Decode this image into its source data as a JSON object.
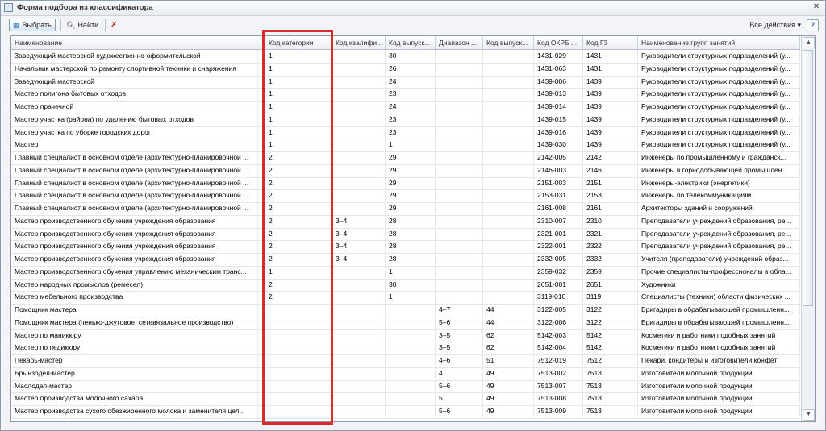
{
  "window": {
    "title": "Форма подбора из классификатора"
  },
  "toolbar": {
    "select_label": "Выбрать",
    "find_label": "Найти...",
    "all_actions": "Все действия ▾",
    "help": "?"
  },
  "grid": {
    "columns": [
      "Наименование",
      "Код категории",
      "Код квалифи...",
      "Код выпуск...",
      "Диапазон ...",
      "Код выпуск...",
      "Код ОКРБ ...",
      "Код ГЗ",
      "Наименование групп занятий"
    ],
    "rows": [
      [
        "Заведующий мастерской художественно-оформительской",
        "1",
        "",
        "30",
        "",
        "",
        "1431-029",
        "1431",
        "Руководители структурных подразделений (у..."
      ],
      [
        "Начальник мастерской по ремонту спортивной техники и снаряжения",
        "1",
        "",
        "26",
        "",
        "",
        "1431-063",
        "1431",
        "Руководители структурных подразделений (у..."
      ],
      [
        "Заведующий мастерской",
        "1",
        "",
        "24",
        "",
        "",
        "1439-006",
        "1439",
        "Руководители структурных подразделений (у..."
      ],
      [
        "Мастер полигона бытовых отходов",
        "1",
        "",
        "23",
        "",
        "",
        "1439-013",
        "1439",
        "Руководители структурных подразделений (у..."
      ],
      [
        "Мастер прачечной",
        "1",
        "",
        "24",
        "",
        "",
        "1439-014",
        "1439",
        "Руководители структурных подразделений (у..."
      ],
      [
        "Мастер участка (района) по удалению бытовых отходов",
        "1",
        "",
        "23",
        "",
        "",
        "1439-015",
        "1439",
        "Руководители структурных подразделений (у..."
      ],
      [
        "Мастер участка по уборке городских дорог",
        "1",
        "",
        "23",
        "",
        "",
        "1439-016",
        "1439",
        "Руководители структурных подразделений (у..."
      ],
      [
        "Мастер",
        "1",
        "",
        "1",
        "",
        "",
        "1439-030",
        "1439",
        "Руководители структурных подразделений (у..."
      ],
      [
        "Главный специалист в основном отделе (архитектурно-планировочной ...",
        "2",
        "",
        "29",
        "",
        "",
        "2142-005",
        "2142",
        "Инженеры по промышленному и гражданск..."
      ],
      [
        "Главный специалист в основном отделе (архитектурно-планировочной ...",
        "2",
        "",
        "29",
        "",
        "",
        "2146-003",
        "2146",
        "Инженеры в горнодобывающей промышлен..."
      ],
      [
        "Главный специалист в основном отделе (архитектурно-планировочной ...",
        "2",
        "",
        "29",
        "",
        "",
        "2151-003",
        "2151",
        "Инженеры-электрики (энергетики)"
      ],
      [
        "Главный специалист в основном отделе (архитектурно-планировочной ...",
        "2",
        "",
        "29",
        "",
        "",
        "2153-031",
        "2153",
        "Инженеры по телекоммуникациям"
      ],
      [
        "Главный специалист в основном отделе (архитектурно-планировочной ...",
        "2",
        "",
        "29",
        "",
        "",
        "2161-008",
        "2161",
        "Архитекторы зданий и сооружений"
      ],
      [
        "Мастер производственного обучения учреждения образования",
        "2",
        "3–4",
        "28",
        "",
        "",
        "2310-007",
        "2310",
        "Преподаватели учреждений образования, ре..."
      ],
      [
        "Мастер производственного обучения учреждения образования",
        "2",
        "3–4",
        "28",
        "",
        "",
        "2321-001",
        "2321",
        "Преподаватели учреждений образования, ре..."
      ],
      [
        "Мастер производственного обучения учреждения образования",
        "2",
        "3–4",
        "28",
        "",
        "",
        "2322-001",
        "2322",
        "Преподаватели учреждений образования, ре..."
      ],
      [
        "Мастер производственного обучения учреждения образования",
        "2",
        "3–4",
        "28",
        "",
        "",
        "2332-005",
        "2332",
        "Учителя (преподаватели) учреждений образ..."
      ],
      [
        "Мастер производственного обучения управлению механическим транс...",
        "1",
        "",
        "1",
        "",
        "",
        "2359-032",
        "2359",
        "Прочие специалисты-профессионалы в обла..."
      ],
      [
        "Мастер народных промыслов (ремесел)",
        "2",
        "",
        "30",
        "",
        "",
        "2651-001",
        "2651",
        "Художники"
      ],
      [
        "Мастер мебельного производства",
        "2",
        "",
        "1",
        "",
        "",
        "3119-010",
        "3119",
        "Специалисты (техники) области физических ..."
      ],
      [
        "Помощник мастера",
        "",
        "",
        "",
        "4–7",
        "44",
        "3122-005",
        "3122",
        "Бригадиры в обрабатывающей промышленн..."
      ],
      [
        "Помощник мастера (пенько-джутовое, сетевязальное производство)",
        "",
        "",
        "",
        "5–6",
        "44",
        "3122-006",
        "3122",
        "Бригадиры в обрабатывающей промышленн..."
      ],
      [
        "Мастер по маникюру",
        "",
        "",
        "",
        "3–5",
        "62",
        "5142-003",
        "5142",
        "Косметики и работники подобных занятий"
      ],
      [
        "Мастер по педикюру",
        "",
        "",
        "",
        "3–5",
        "62",
        "5142-004",
        "5142",
        "Косметики и работники подобных занятий"
      ],
      [
        "Пекарь-мастер",
        "",
        "",
        "",
        "4–6",
        "51",
        "7512-019",
        "7512",
        "Пекари, кондитеры и изготовители конфет"
      ],
      [
        "Брынзодел-мастер",
        "",
        "",
        "",
        "4",
        "49",
        "7513-002",
        "7513",
        "Изготовители молочной продукции"
      ],
      [
        "Маслодел-мастер",
        "",
        "",
        "",
        "5–6",
        "49",
        "7513-007",
        "7513",
        "Изготовители молочной продукции"
      ],
      [
        "Мастер производства молочного сахара",
        "",
        "",
        "",
        "5",
        "49",
        "7513-008",
        "7513",
        "Изготовители молочной продукции"
      ],
      [
        "Мастер производства сухого обезжиренного молока и заменителя цел...",
        "",
        "",
        "",
        "5–6",
        "49",
        "7513-009",
        "7513",
        "Изготовители молочной продукции"
      ]
    ]
  },
  "colors": {
    "highlight": "#d92b2b",
    "border": "#8a9bb0"
  }
}
